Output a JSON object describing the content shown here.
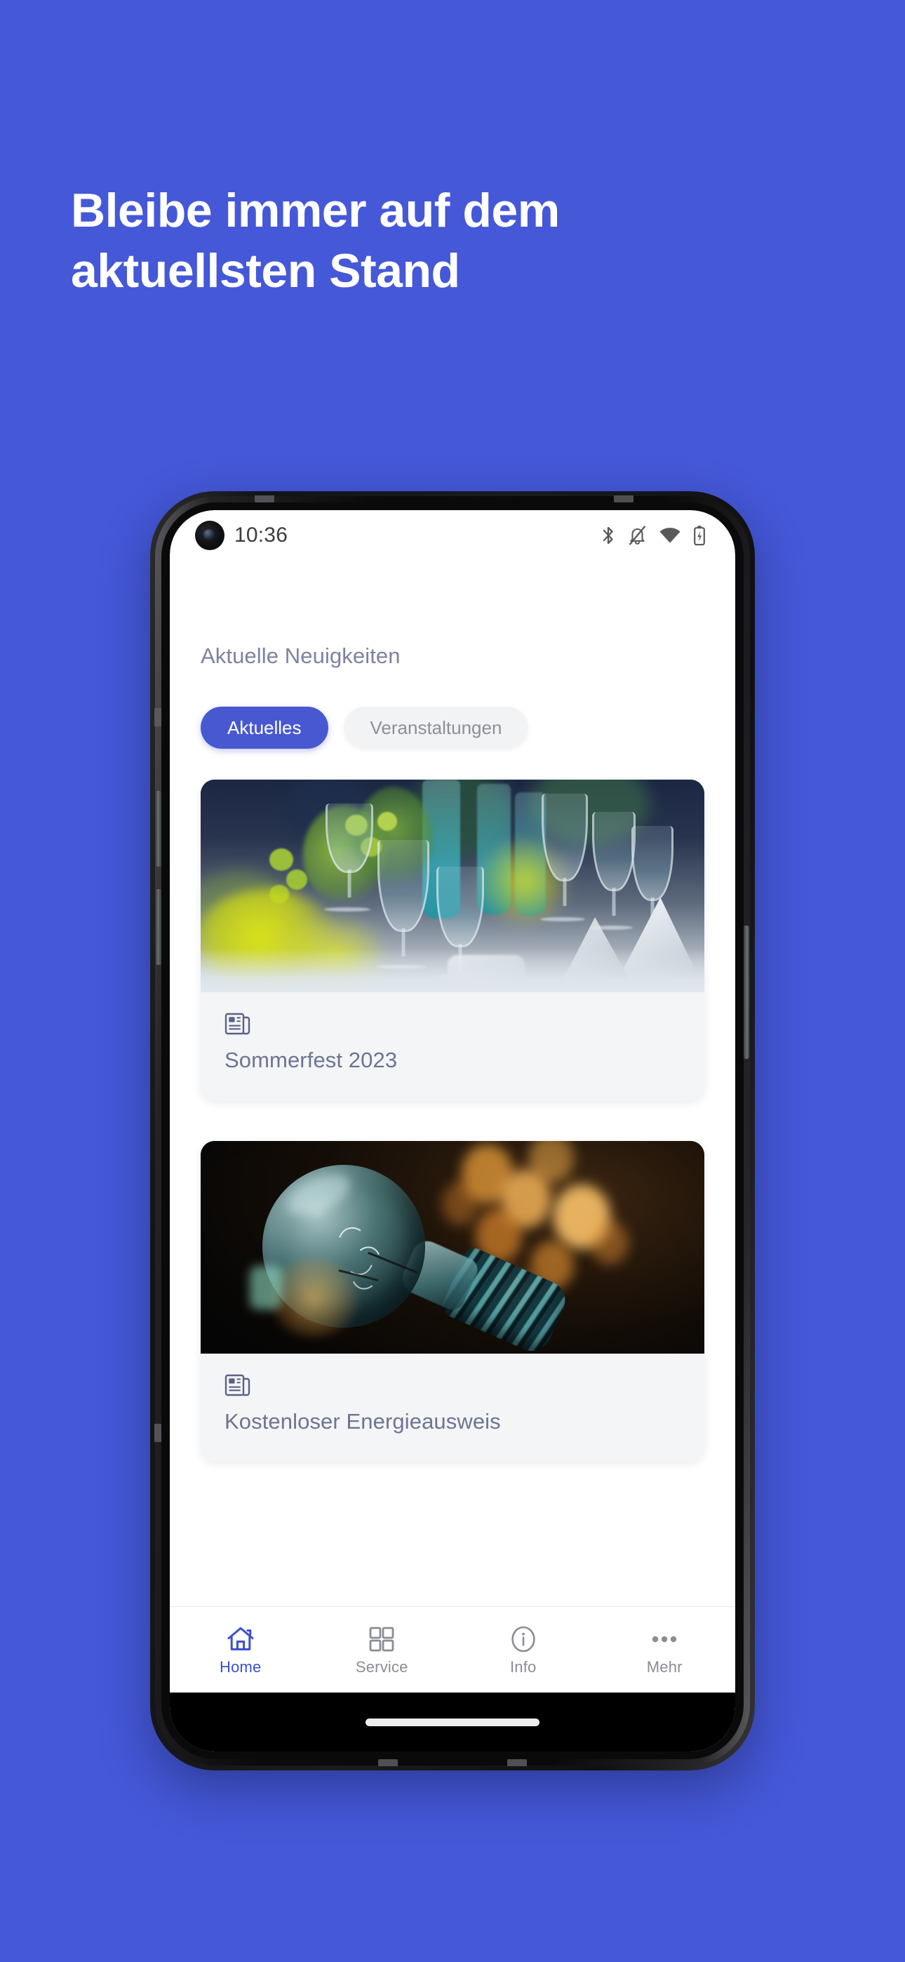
{
  "promo": {
    "headline": "Bleibe immer auf dem\naktuellsten Stand",
    "background_color": "#4558D8",
    "headline_color": "#FFFFFF"
  },
  "status_bar": {
    "time": "10:36",
    "icons": [
      {
        "name": "bluetooth-icon",
        "label": "Bluetooth"
      },
      {
        "name": "notifications-off-icon",
        "label": "Benachrichtigungen stumm"
      },
      {
        "name": "wifi-icon",
        "label": "WLAN"
      },
      {
        "name": "battery-charging-icon",
        "label": "Akku lädt"
      }
    ],
    "camera": "front-camera-punch-hole"
  },
  "app": {
    "section_title": "Aktuelle Neuigkeiten",
    "accent_color": "#4758D0",
    "tabs": [
      {
        "label": "Aktuelles",
        "active": true
      },
      {
        "label": "Veranstaltungen",
        "active": false
      }
    ],
    "cards": [
      {
        "title": "Sommerfest 2023",
        "icon": "newspaper-icon",
        "image_alt": "Festlich gedeckter Tisch mit Weingläsern, grünen Zweigen und gelben Blüten"
      },
      {
        "title": "Kostenloser Energieausweis",
        "icon": "newspaper-icon",
        "image_alt": "Glühbirne vor dunklem Hintergrund mit orangefarbenem Bokeh"
      }
    ],
    "bottom_nav": [
      {
        "label": "Home",
        "icon": "home-icon",
        "active": true
      },
      {
        "label": "Service",
        "icon": "grid-icon",
        "active": false
      },
      {
        "label": "Info",
        "icon": "info-icon",
        "active": false
      },
      {
        "label": "Mehr",
        "icon": "ellipsis-icon",
        "active": false
      }
    ]
  }
}
